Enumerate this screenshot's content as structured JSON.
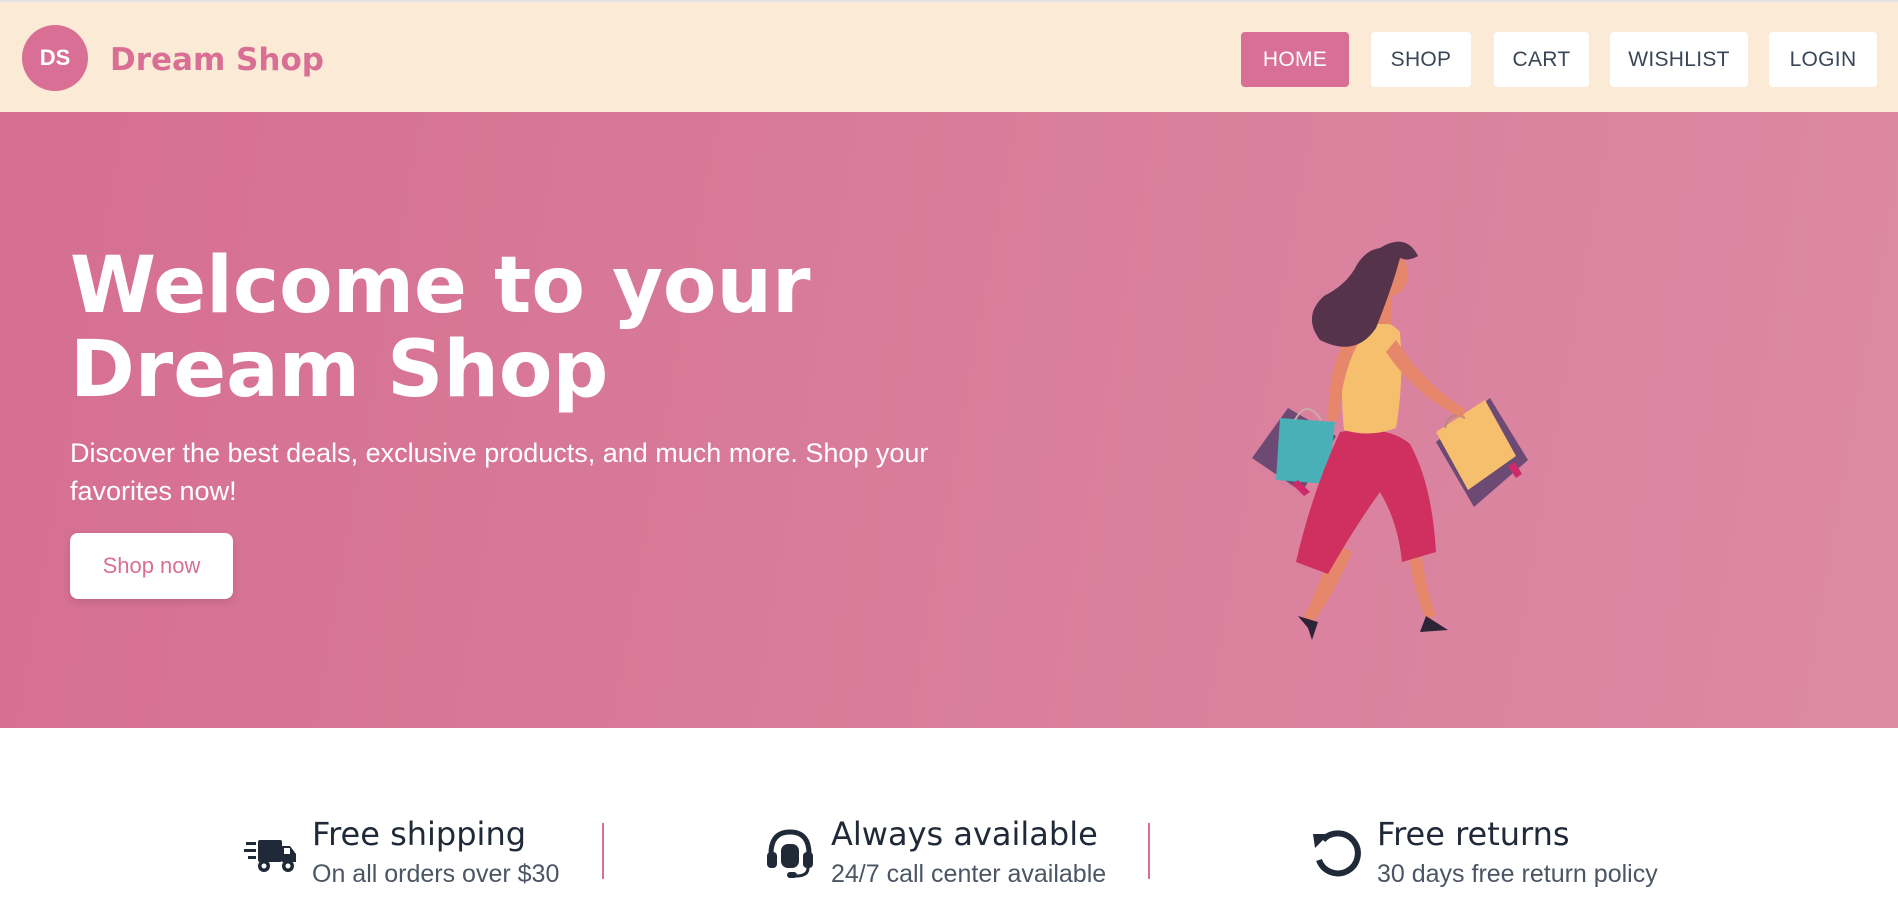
{
  "header": {
    "logo_initials": "DS",
    "brand": "Dream Shop",
    "nav": [
      {
        "label": "HOME",
        "active": true
      },
      {
        "label": "SHOP",
        "active": false
      },
      {
        "label": "CART",
        "active": false
      },
      {
        "label": "WISHLIST",
        "active": false
      },
      {
        "label": "LOGIN",
        "active": false
      }
    ]
  },
  "hero": {
    "title_line1": "Welcome to your",
    "title_line2": "Dream Shop",
    "subtitle": "Discover the best deals, exclusive products, and much more. Shop your favorites now!",
    "cta_label": "Shop now",
    "illustration": "woman-shopping-bags-illustration"
  },
  "features": [
    {
      "icon": "shipping-truck-icon",
      "title": "Free shipping",
      "description": "On all orders over $30"
    },
    {
      "icon": "headset-icon",
      "title": "Always available",
      "description": "24/7 call center available"
    },
    {
      "icon": "return-arrow-icon",
      "title": "Free returns",
      "description": "30 days free return policy"
    }
  ],
  "colors": {
    "accent": "#d96f95",
    "header_bg": "#fbebd6",
    "text_dark": "#1f2937"
  }
}
